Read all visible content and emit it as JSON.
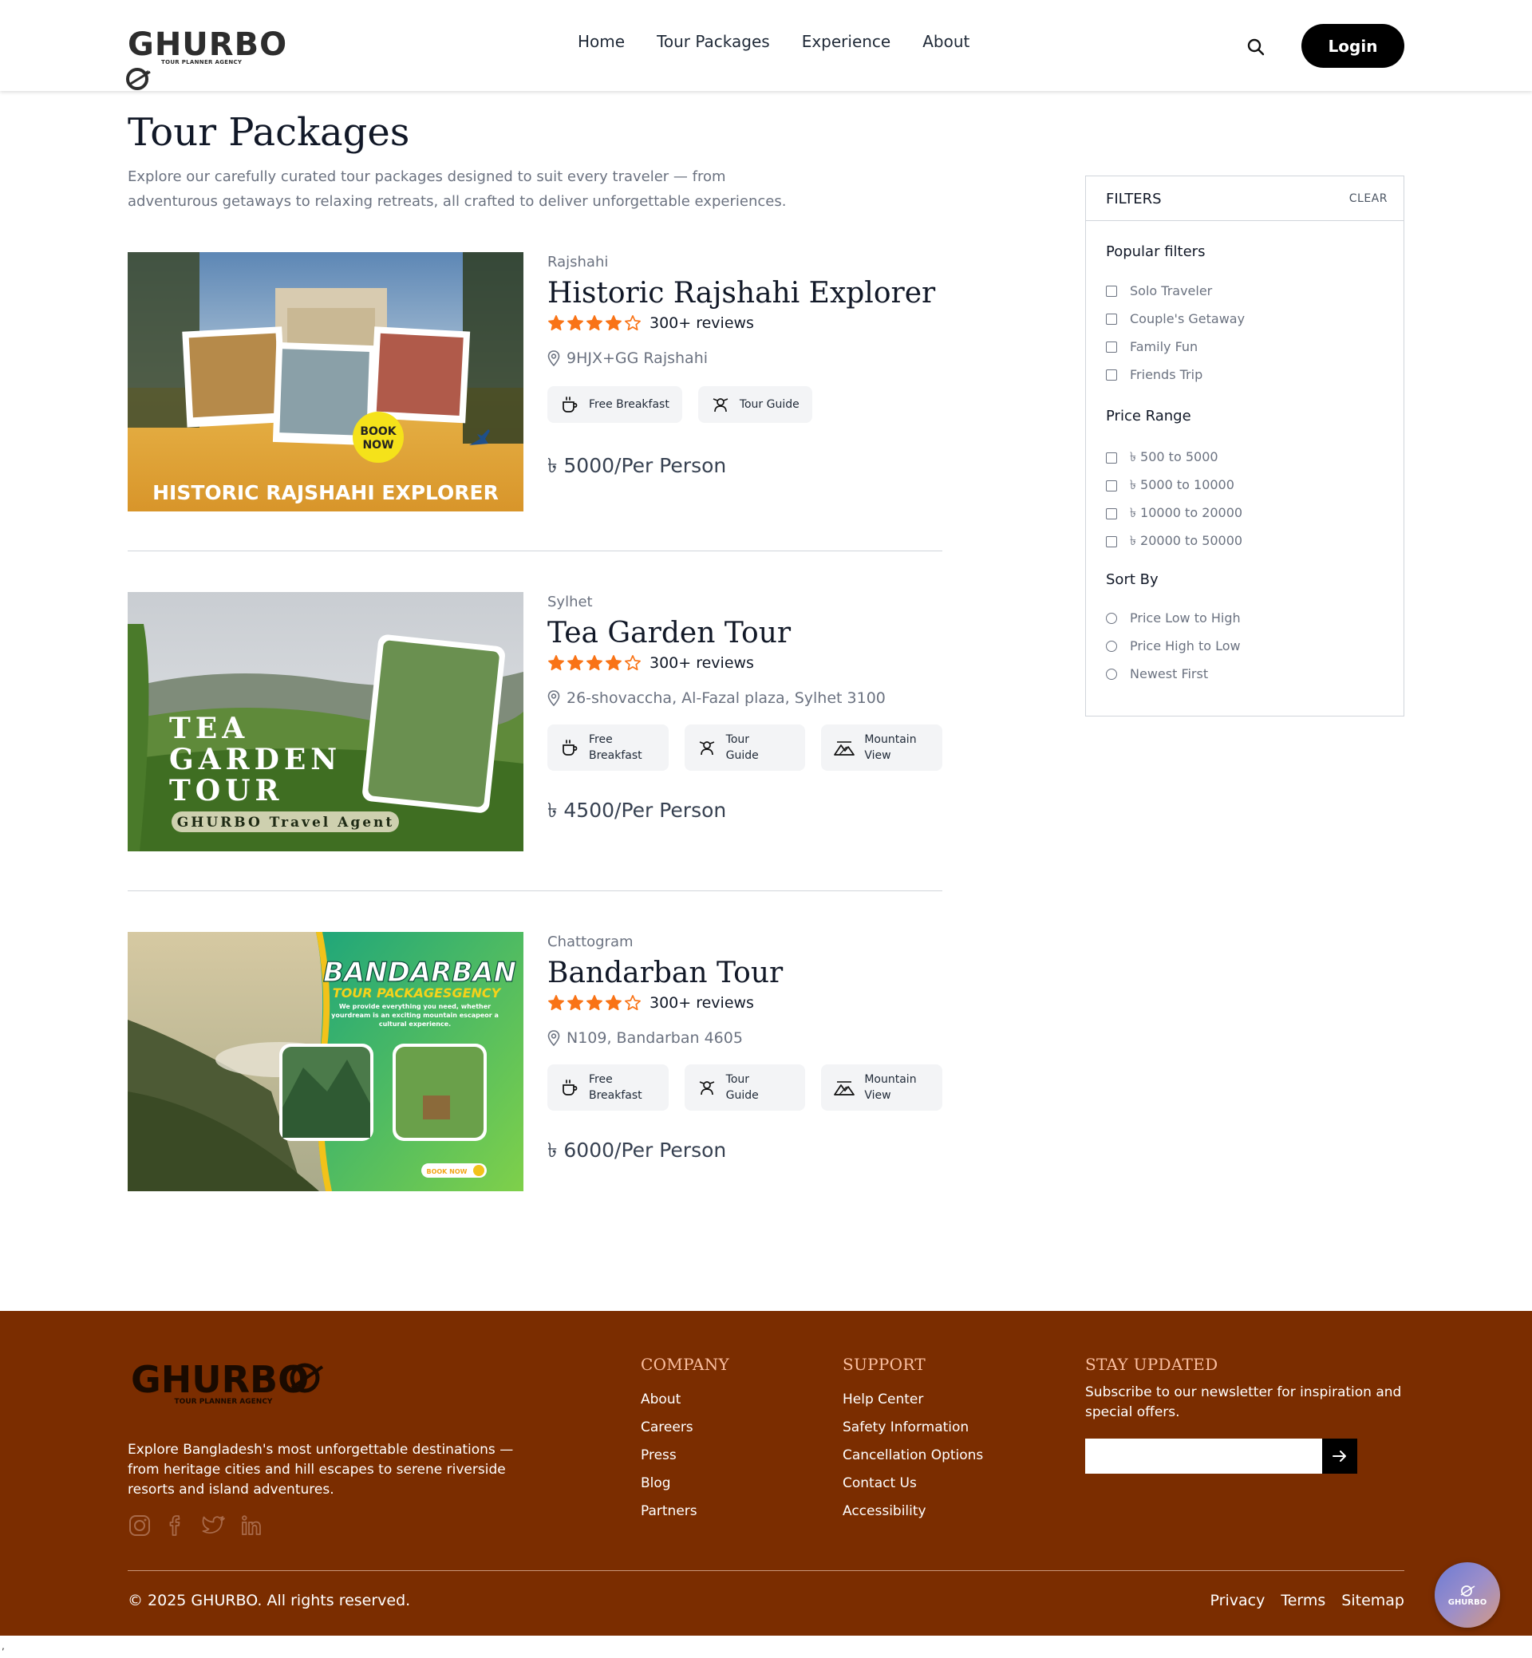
{
  "header": {
    "logo_text": "GHURBO",
    "logo_tagline": "TOUR PLANNER AGENCY",
    "nav": [
      "Home",
      "Tour Packages",
      "Experience",
      "About"
    ],
    "login_label": "Login"
  },
  "page": {
    "title": "Tour Packages",
    "description": "Explore our carefully curated tour packages designed to suit every traveler — from adventurous getaways to relaxing retreats, all crafted to deliver unforgettable experiences."
  },
  "packages": [
    {
      "city": "Rajshahi",
      "title": "Historic Rajshahi Explorer",
      "rating": 4,
      "reviews": "300+ reviews",
      "location": "9HJX+GG Rajshahi",
      "features": [
        "Free Breakfast",
        "Tour Guide"
      ],
      "price": "৳ 5000/Per Person",
      "image": {
        "banner": "HISTORIC RAJSHAHI EXPLORER",
        "badge_line1": "BOOK",
        "badge_line2": "NOW"
      }
    },
    {
      "city": "Sylhet",
      "title": "Tea Garden Tour",
      "rating": 4,
      "reviews": "300+ reviews",
      "location": "26-shovaccha, Al-Fazal plaza, Sylhet 3100",
      "features": [
        "Free Breakfast",
        "Tour Guide",
        "Mountain View"
      ],
      "price": "৳ 4500/Per Person",
      "image": {
        "line1": "TEA",
        "line2": "GARDEN",
        "line3": "TOUR",
        "sub": "GHURBO Travel Agent"
      }
    },
    {
      "city": "Chattogram",
      "title": "Bandarban Tour",
      "rating": 4,
      "reviews": "300+ reviews",
      "location": "N109, Bandarban 4605",
      "features": [
        "Free Breakfast",
        "Tour Guide",
        "Mountain View"
      ],
      "price": "৳ 6000/Per Person",
      "image": {
        "title": "BANDARBAN",
        "subtitle": "TOUR PACKAGESGENCY",
        "blurb": "We provide everything you need, whether yourdream is an exciting mountain escapeor a cultural experience.",
        "cta": "BOOK NOW"
      }
    }
  ],
  "filters": {
    "title": "FILTERS",
    "clear_label": "CLEAR",
    "popular_title": "Popular filters",
    "popular": [
      "Solo Traveler",
      "Couple's Getaway",
      "Family Fun",
      "Friends Trip"
    ],
    "price_title": "Price Range",
    "price_ranges": [
      "৳ 500 to 5000",
      "৳ 5000 to 10000",
      "৳ 10000 to 20000",
      "৳ 20000 to 50000"
    ],
    "sort_title": "Sort By",
    "sort_options": [
      "Price Low to High",
      "Price High to Low",
      "Newest First"
    ]
  },
  "footer": {
    "logo_text": "GHURBO",
    "logo_tagline": "TOUR PLANNER AGENCY",
    "about": "Explore Bangladesh's most unforgettable destinations — from heritage cities and hill escapes to serene riverside resorts and island adventures.",
    "company_title": "COMPANY",
    "company_links": [
      "About",
      "Careers",
      "Press",
      "Blog",
      "Partners"
    ],
    "support_title": "SUPPORT",
    "support_links": [
      "Help Center",
      "Safety Information",
      "Cancellation Options",
      "Contact Us",
      "Accessibility"
    ],
    "newsletter_title": "STAY UPDATED",
    "newsletter_text": "Subscribe to our newsletter for inspiration and special offers.",
    "newsletter_placeholder": "",
    "copyright": "© 2025 GHURBO. All rights reserved.",
    "bottom_links": [
      "Privacy",
      "Terms",
      "Sitemap"
    ],
    "chat_label": "GHURBO"
  },
  "stray_mark": ",",
  "colors": {
    "star": "#f97316",
    "footer_bg": "#7b2d00",
    "login_bg": "#000000"
  }
}
